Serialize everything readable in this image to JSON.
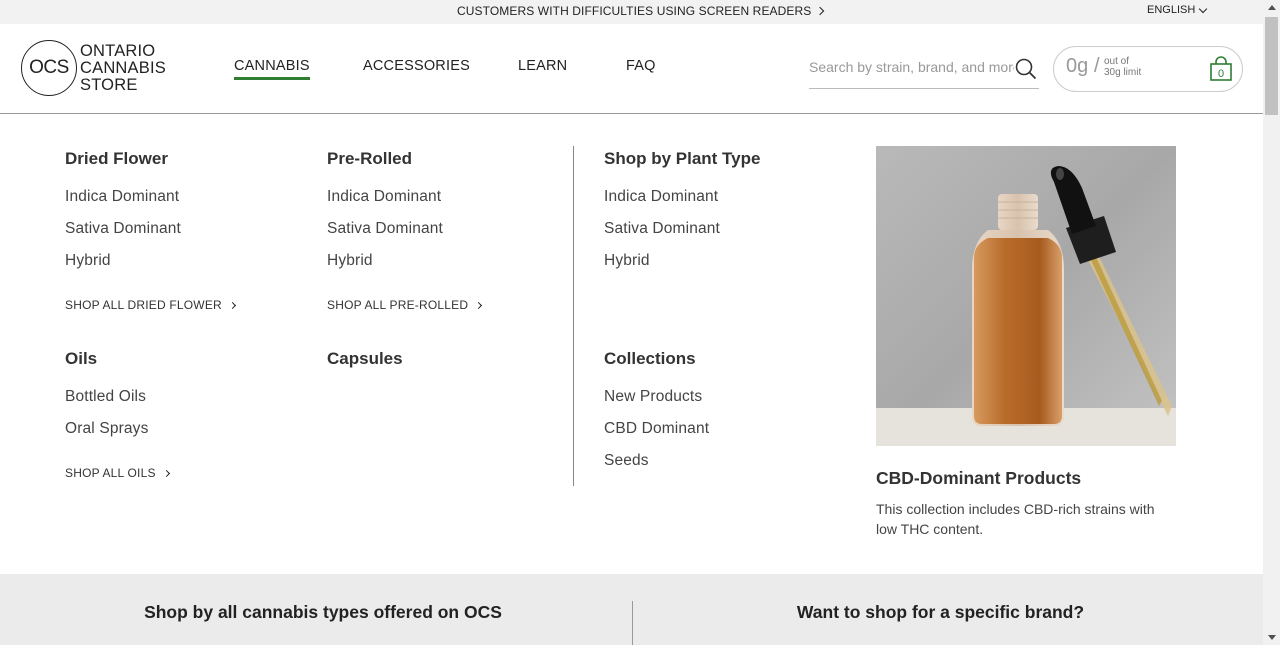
{
  "topbar": {
    "accessibility_text": "CUSTOMERS WITH DIFFICULTIES USING SCREEN READERS",
    "language": "ENGLISH"
  },
  "header": {
    "logo_abbr": "OCS",
    "logo_line1": "ONTARIO",
    "logo_line2": "CANNABIS",
    "logo_line3": "STORE",
    "nav": [
      {
        "label": "CANNABIS",
        "active": true
      },
      {
        "label": "ACCESSORIES",
        "active": false
      },
      {
        "label": "LEARN",
        "active": false
      },
      {
        "label": "FAQ",
        "active": false
      }
    ],
    "search_placeholder": "Search by strain, brand, and more",
    "cart": {
      "grams": "0g",
      "slash": "/",
      "limit_line1": "out of",
      "limit_line2": "30g limit",
      "count": "0"
    }
  },
  "mega_menu": {
    "dried_flower": {
      "heading": "Dried Flower",
      "items": [
        "Indica Dominant",
        "Sativa Dominant",
        "Hybrid"
      ],
      "shop_all": "SHOP ALL DRIED FLOWER"
    },
    "pre_rolled": {
      "heading": "Pre-Rolled",
      "items": [
        "Indica Dominant",
        "Sativa Dominant",
        "Hybrid"
      ],
      "shop_all": "SHOP ALL PRE-ROLLED"
    },
    "oils": {
      "heading": "Oils",
      "items": [
        "Bottled Oils",
        "Oral Sprays"
      ],
      "shop_all": "SHOP ALL OILS"
    },
    "capsules": {
      "heading": "Capsules"
    },
    "plant_type": {
      "heading": "Shop by Plant Type",
      "items": [
        "Indica Dominant",
        "Sativa Dominant",
        "Hybrid"
      ]
    },
    "collections": {
      "heading": "Collections",
      "items": [
        "New Products",
        "CBD Dominant",
        "Seeds"
      ]
    },
    "promo": {
      "title": "CBD-Dominant Products",
      "description": "This collection includes CBD-rich strains with low THC content."
    }
  },
  "bottom_band": {
    "left_heading": "Shop by all cannabis types offered on OCS",
    "right_heading": "Want to shop for a specific brand?"
  },
  "colors": {
    "accent_green": "#2e7d32",
    "topbar_bg": "#f2f2f2",
    "bottom_bg": "#ebebeb"
  }
}
